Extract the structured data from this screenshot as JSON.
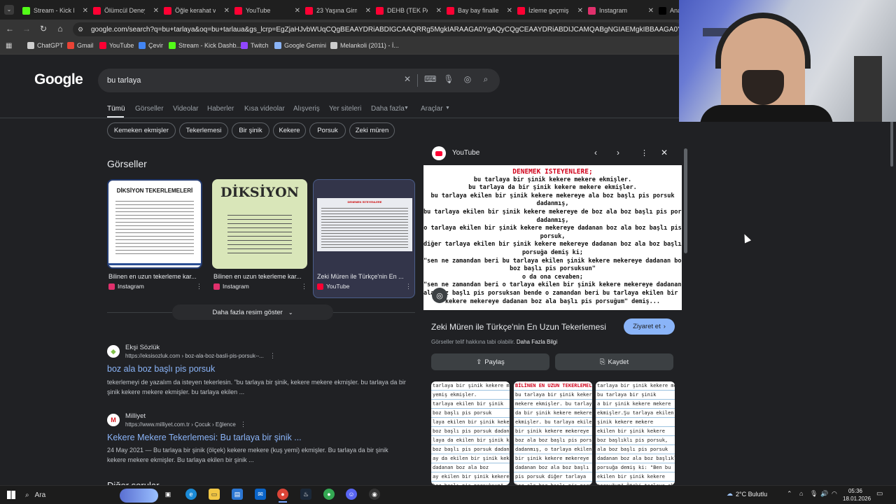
{
  "browser": {
    "tabs": [
      {
        "label": "Stream - Kick D",
        "icon": "kick-icon",
        "color": "#53fc18"
      },
      {
        "label": "Ölümcül Deney",
        "icon": "youtube-icon",
        "color": "#ff0033"
      },
      {
        "label": "Öğle kerahat v",
        "icon": "youtube-icon",
        "color": "#ff0033"
      },
      {
        "label": "YouTube",
        "icon": "youtube-icon",
        "color": "#ff0033"
      },
      {
        "label": "23 Yaşına Girm",
        "icon": "youtube-icon",
        "color": "#ff0033"
      },
      {
        "label": "DEHB (TEK PA",
        "icon": "youtube-icon",
        "color": "#ff0033"
      },
      {
        "label": "Bay bay finalle",
        "icon": "youtube-icon",
        "color": "#ff0033"
      },
      {
        "label": "İzleme geçmiş",
        "icon": "youtube-icon",
        "color": "#ff0033"
      },
      {
        "label": "Instagram",
        "icon": "instagram-icon",
        "color": "#e1306c"
      },
      {
        "label": "Ana",
        "icon": "x-icon",
        "color": "#000000"
      }
    ],
    "url": "google.com/search?q=bu+tarlaya&oq=bu+tarlaua&gs_lcrp=EgZjaHJvbWUqCQgBEAAYDRiABDIGCAAQRRg5MgkIARAAGA0YgAQyCQgCEAAYDRiABDIJCAMQABgNGIAEMgkIBBAAGA0YgAQyCQgFEAAYDRiA",
    "bookmarks": [
      {
        "label": "ChatGPT",
        "icon": "chatgpt-icon",
        "color": "#cfcfcf"
      },
      {
        "label": "Gmail",
        "icon": "gmail-icon",
        "color": "#ea4335"
      },
      {
        "label": "YouTube",
        "icon": "youtube-icon",
        "color": "#ff0033"
      },
      {
        "label": "Çevir",
        "icon": "translate-icon",
        "color": "#4285f4"
      },
      {
        "label": "Stream - Kick Dashb...",
        "icon": "kick-icon",
        "color": "#53fc18"
      },
      {
        "label": "Twitch",
        "icon": "twitch-icon",
        "color": "#9146ff"
      },
      {
        "label": "Google Gemini",
        "icon": "gemini-icon",
        "color": "#8ab4f8"
      },
      {
        "label": "Melankoli (2011) - İ...",
        "icon": "page-icon",
        "color": "#cccccc"
      }
    ]
  },
  "google": {
    "logo": "Google",
    "query": "bu tarlaya",
    "tabs": [
      "Tümü",
      "Görseller",
      "Videolar",
      "Haberler",
      "Kısa videolar",
      "Alışveriş",
      "Yer siteleri",
      "Daha fazla",
      "Araçlar"
    ],
    "chips": [
      "Kemeken ekmişler",
      "Tekerlemesi",
      "Bir şinik",
      "Kekere",
      "Porsuk",
      "Zeki müren"
    ],
    "images_heading": "Görseller",
    "images": [
      {
        "caption": "Bilinen en uzun tekerleme kar...",
        "source": "Instagram",
        "thumb_title": "DİKSİYON TEKERLEMELERİ"
      },
      {
        "caption": "Bilinen en uzun tekerleme kar...",
        "source": "Instagram",
        "thumb_title": "DİKSİYON"
      },
      {
        "caption": "Zeki Müren ile Türkçe'nin En ...",
        "source": "YouTube",
        "thumb_title": "DENEMEK İSTEYENLERE"
      }
    ],
    "more_images": "Daha fazla resim göster",
    "results": [
      {
        "site": "Ekşi Sözlük",
        "url": "https://eksisozluk.com › boz-ala-boz-basli-pis-porsuk--...",
        "title": "boz ala boz başlı pis porsuk",
        "snippet": "tekerlemeyi de yazalım da isteyen tekerlesin. \"bu tarlaya bir şinik, kekere mekere ekmişler. bu tarlaya da bir şinik kekere mekere ekmişler. bu tarlaya ekilen ..."
      },
      {
        "site": "Milliyet",
        "url": "https://www.milliyet.com.tr › Çocuk › Eğlence",
        "title": "Kekere Mekere Tekerlemesi: Bu tarlaya bir şinik ...",
        "snippet": "24 May 2021 — Bu tarlaya bir şinik (ölçek) kekere mekere (kuş yemi) ekmişler. Bu tarlaya da bir şinik kekere mekere ekmişler. Bu tarlaya ekilen bir şinik ..."
      }
    ],
    "next_heading": "Diğer sorular"
  },
  "panel": {
    "source": "YouTube",
    "image_lines": [
      "DENEMEK İSTEYENLERE;",
      "bu tarlaya bir şinik kekere mekere ekmişler.",
      "bu tarlaya da bir şinik kekere mekere ekmişler.",
      "bu tarlaya ekilen bir şinik kekere mekereye alа boz başlı pis porsuk",
      "dadanmış,",
      "bu tarlaya ekilen bir şinik kekere mekereye de boz ala boz başlı pis porsuk",
      "dadanmış,",
      "o tarlaya ekilen bir şinik kekere mekereye dadanan boz ala boz başlı pis",
      "porsuk,",
      "diğer tarlaya ekilen bir şinik kekere mekereye dadanan boz ala boz başlı pis",
      "porsuğa demiş ki;",
      "\"sen ne zamandan beri bu tarlaya ekilen şinik kekere mekereye dadanan boz ala",
      "boz başlı pis porsuksun\"",
      "o da ona cevaben;",
      "\"sen ne zamandan beri o tarlaya ekilen bir şinik kekere mekereye dadanan boz",
      "ala boz başlı pis porsuksan bende o zamandan beri bu tarlaya ekilen bir şinik",
      "kekere mekereye dadanan boz ala başlı pis porsuğum\" demiş..."
    ],
    "title": "Zeki Müren ile Türkçe'nin En Uzun Tekerlemesi",
    "visit": "Ziyaret et",
    "copyright": "Görseller telif hakkına tabi olabilir.",
    "more_info": "Daha Fazla Bilgi",
    "share": "Paylaş",
    "save": "Kaydet",
    "related": [
      [
        "tarlaya bir şinik kekere meke",
        "yemiş ekmişler.",
        "tarlaya ekilen bir şinik",
        "boz başlı pis porsuk",
        "laya ekilen bir şinik kekere",
        "boz başlı pis porsuk dadanmış.",
        "laya da ekilen bir şinik kekere",
        "boz başlı pis porsuk dadanmış.",
        "ay da ekilen bir şinik kekere",
        "dadanan boz ala boz",
        "ay ekilen bir şinik kekere",
        "boz başlı pis porsuksun\""
      ],
      [
        "BİLİNEN EN UZUN TEKERLEMELER",
        "bu tarlaya bir şinik kekere",
        "mekere ekmişler. bu tarlaya",
        "da bir şinik kekere mekere",
        "ekmişler. bu tarlaya ekilen",
        "bir şinik kekere mekereye",
        "boz ala boz başlı pis porsuk",
        "dadanmış, o tarlaya ekilen",
        "bir şinik kekere mekereye",
        "dadanan boz ala boz başlı",
        "pis porsuk diğer tarlaya",
        "boz ala boz başlı pis porsuk"
      ],
      [
        "tarlaya bir şinik kekere meke",
        "bu tarlaya bir şinik",
        "a bir şinik kekere mekere",
        "ekmişler.Şu tarlaya ekilen",
        "şinik kekere mekere",
        "ekilen bir şinik kekere",
        "boz başlıklı pis porsuk,",
        "ala boz başlı pis porsuk",
        "dadanan boz ala boz başlıklı",
        "porsuğa demiş ki: \"Ben bu",
        "ekilen bir şinik kekere",
        "porsuğum\".Öteki tarlaya ekilen"
      ]
    ]
  },
  "taskbar": {
    "search_placeholder": "Ara",
    "weather": "2°C  Bulutlu",
    "time": "05:36",
    "date": "18.01.2026"
  }
}
